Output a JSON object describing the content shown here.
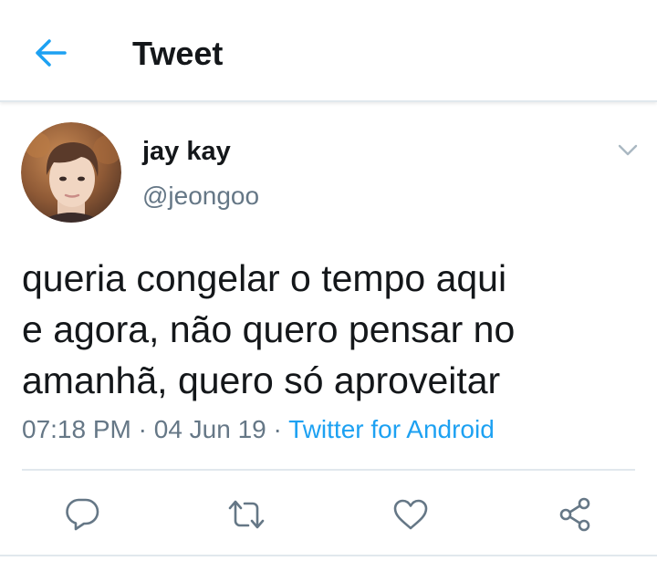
{
  "header": {
    "title": "Tweet",
    "back_icon": "arrow-left-icon"
  },
  "colors": {
    "accent": "#1da1f2",
    "text_primary": "#14171a",
    "text_secondary": "#657786",
    "divider": "#e1e8ed"
  },
  "tweet": {
    "author": {
      "display_name": "jay kay",
      "handle": "@jeongoo",
      "avatar_icon": "avatar"
    },
    "menu_icon": "chevron-down-icon",
    "text_lines": [
      "queria congelar o tempo aqui",
      "e agora, não quero pensar no",
      "amanhã, quero só aproveitar"
    ],
    "time": "07:18 PM",
    "separator": " · ",
    "date": "04 Jun 19",
    "client": "Twitter for Android"
  },
  "actions": [
    {
      "name": "reply",
      "icon": "reply-icon"
    },
    {
      "name": "retweet",
      "icon": "retweet-icon"
    },
    {
      "name": "like",
      "icon": "heart-icon"
    },
    {
      "name": "share",
      "icon": "share-icon"
    }
  ]
}
